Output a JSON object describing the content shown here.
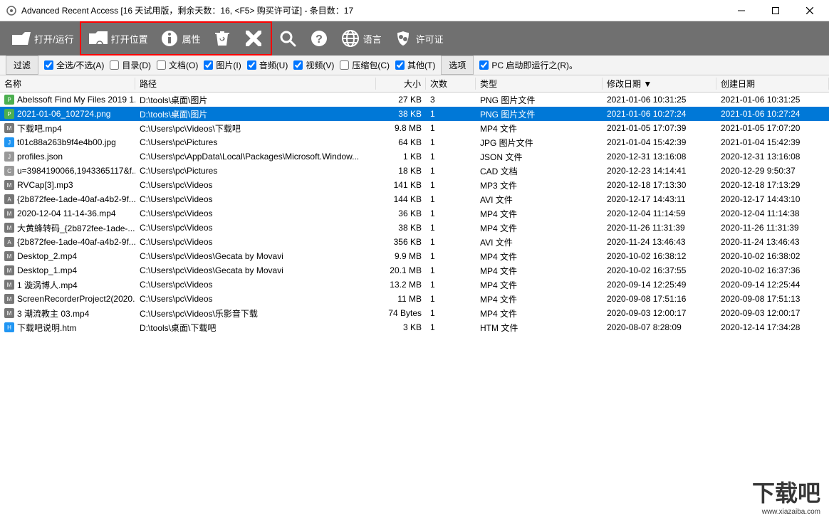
{
  "titlebar": {
    "text": "Advanced Recent Access [16 天试用版，剩余天数：16, <F5> 购买许可证] - 条目数：17"
  },
  "toolbar": {
    "open_run": "打开/运行",
    "open_location": "打开位置",
    "properties": "属性",
    "language": "语言",
    "license": "许可证"
  },
  "filterbar": {
    "filter_tab": "过滤",
    "options_tab": "选项",
    "select_all": "全选/不选(A)",
    "dir": "目录(D)",
    "doc": "文档(O)",
    "img": "图片(I)",
    "audio": "音频(U)",
    "video": "视频(V)",
    "archive": "压缩包(C)",
    "other": "其他(T)",
    "startup": "PC 启动即运行之(R)。"
  },
  "columns": {
    "name": "名称",
    "path": "路径",
    "size": "大小",
    "count": "次数",
    "type": "类型",
    "modified": "修改日期 ▼",
    "created": "创建日期"
  },
  "rows": [
    {
      "icon": "png",
      "iconColor": "#4caf50",
      "name": "Abelssoft Find My Files 2019 1...",
      "path": "D:\\tools\\桌面\\图片",
      "size": "27 KB",
      "count": "3",
      "type": "PNG 图片文件",
      "modified": "2021-01-06 10:31:25",
      "created": "2021-01-06 10:31:25",
      "sel": false
    },
    {
      "icon": "png",
      "iconColor": "#4caf50",
      "name": "2021-01-06_102724.png",
      "path": "D:\\tools\\桌面\\图片",
      "size": "38 KB",
      "count": "1",
      "type": "PNG 图片文件",
      "modified": "2021-01-06 10:27:24",
      "created": "2021-01-06 10:27:24",
      "sel": true
    },
    {
      "icon": "mp4",
      "iconColor": "#777",
      "name": "下载吧.mp4",
      "path": "C:\\Users\\pc\\Videos\\下载吧",
      "size": "9.8 MB",
      "count": "1",
      "type": "MP4 文件",
      "modified": "2021-01-05 17:07:39",
      "created": "2021-01-05 17:07:20"
    },
    {
      "icon": "jpg",
      "iconColor": "#2196f3",
      "name": "t01c88a263b9f4e4b00.jpg",
      "path": "C:\\Users\\pc\\Pictures",
      "size": "64 KB",
      "count": "1",
      "type": "JPG 图片文件",
      "modified": "2021-01-04 15:42:39",
      "created": "2021-01-04 15:42:39"
    },
    {
      "icon": "json",
      "iconColor": "#999",
      "name": "profiles.json",
      "path": "C:\\Users\\pc\\AppData\\Local\\Packages\\Microsoft.Window...",
      "size": "1 KB",
      "count": "1",
      "type": "JSON 文件",
      "modified": "2020-12-31 13:16:08",
      "created": "2020-12-31 13:16:08"
    },
    {
      "icon": "cad",
      "iconColor": "#999",
      "name": "u=3984190066,1943365117&f...",
      "path": "C:\\Users\\pc\\Pictures",
      "size": "18 KB",
      "count": "1",
      "type": "CAD 文档",
      "modified": "2020-12-23 14:14:41",
      "created": "2020-12-29 9:50:37"
    },
    {
      "icon": "mp3",
      "iconColor": "#777",
      "name": "RVCap[3].mp3",
      "path": "C:\\Users\\pc\\Videos",
      "size": "141 KB",
      "count": "1",
      "type": "MP3 文件",
      "modified": "2020-12-18 17:13:30",
      "created": "2020-12-18 17:13:29"
    },
    {
      "icon": "avi",
      "iconColor": "#777",
      "name": "{2b872fee-1ade-40af-a4b2-9f...",
      "path": "C:\\Users\\pc\\Videos",
      "size": "144 KB",
      "count": "1",
      "type": "AVI 文件",
      "modified": "2020-12-17 14:43:11",
      "created": "2020-12-17 14:43:10"
    },
    {
      "icon": "mp4",
      "iconColor": "#777",
      "name": "2020-12-04 11-14-36.mp4",
      "path": "C:\\Users\\pc\\Videos",
      "size": "36 KB",
      "count": "1",
      "type": "MP4 文件",
      "modified": "2020-12-04 11:14:59",
      "created": "2020-12-04 11:14:38"
    },
    {
      "icon": "mp4",
      "iconColor": "#777",
      "name": "大黄蜂转码_{2b872fee-1ade-...",
      "path": "C:\\Users\\pc\\Videos",
      "size": "38 KB",
      "count": "1",
      "type": "MP4 文件",
      "modified": "2020-11-26 11:31:39",
      "created": "2020-11-26 11:31:39"
    },
    {
      "icon": "avi",
      "iconColor": "#777",
      "name": "{2b872fee-1ade-40af-a4b2-9f...",
      "path": "C:\\Users\\pc\\Videos",
      "size": "356 KB",
      "count": "1",
      "type": "AVI 文件",
      "modified": "2020-11-24 13:46:43",
      "created": "2020-11-24 13:46:43"
    },
    {
      "icon": "mp4",
      "iconColor": "#777",
      "name": "Desktop_2.mp4",
      "path": "C:\\Users\\pc\\Videos\\Gecata by Movavi",
      "size": "9.9 MB",
      "count": "1",
      "type": "MP4 文件",
      "modified": "2020-10-02 16:38:12",
      "created": "2020-10-02 16:38:02"
    },
    {
      "icon": "mp4",
      "iconColor": "#777",
      "name": "Desktop_1.mp4",
      "path": "C:\\Users\\pc\\Videos\\Gecata by Movavi",
      "size": "20.1 MB",
      "count": "1",
      "type": "MP4 文件",
      "modified": "2020-10-02 16:37:55",
      "created": "2020-10-02 16:37:36"
    },
    {
      "icon": "mp4",
      "iconColor": "#777",
      "name": "1 漩涡博人.mp4",
      "path": "C:\\Users\\pc\\Videos",
      "size": "13.2 MB",
      "count": "1",
      "type": "MP4 文件",
      "modified": "2020-09-14 12:25:49",
      "created": "2020-09-14 12:25:44"
    },
    {
      "icon": "mp4",
      "iconColor": "#777",
      "name": "ScreenRecorderProject2(2020...",
      "path": "C:\\Users\\pc\\Videos",
      "size": "11 MB",
      "count": "1",
      "type": "MP4 文件",
      "modified": "2020-09-08 17:51:16",
      "created": "2020-09-08 17:51:13"
    },
    {
      "icon": "mp4",
      "iconColor": "#777",
      "name": "3 潮流教主 03.mp4",
      "path": "C:\\Users\\pc\\Videos\\乐影音下载",
      "size": "74 Bytes",
      "count": "1",
      "type": "MP4 文件",
      "modified": "2020-09-03 12:00:17",
      "created": "2020-09-03 12:00:17"
    },
    {
      "icon": "htm",
      "iconColor": "#2196f3",
      "name": "下载吧说明.htm",
      "path": "D:\\tools\\桌面\\下载吧",
      "size": "3 KB",
      "count": "1",
      "type": "HTM 文件",
      "modified": "2020-08-07 8:28:09",
      "created": "2020-12-14 17:34:28"
    }
  ],
  "watermark": {
    "main": "下载吧",
    "sub": "www.xiazaiba.com"
  }
}
